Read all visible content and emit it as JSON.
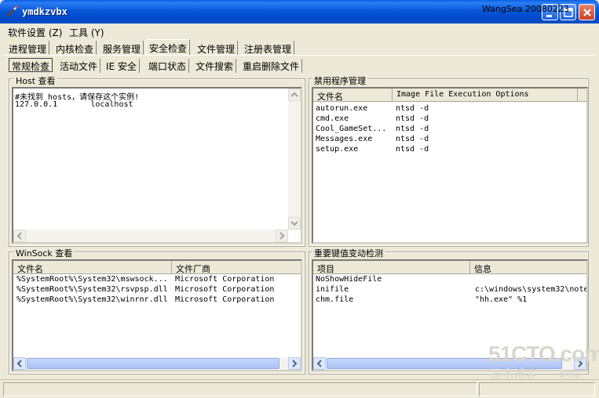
{
  "window": {
    "title": "ymdkzvbx"
  },
  "menu": [
    {
      "label": "软件设置 (Z)"
    },
    {
      "label": "工具 (Y)"
    }
  ],
  "main_tabs": [
    {
      "label": "进程管理"
    },
    {
      "label": "内核检查"
    },
    {
      "label": "服务管理"
    },
    {
      "label": "安全检查"
    },
    {
      "label": "文件管理"
    },
    {
      "label": "注册表管理"
    }
  ],
  "sub_tabs": [
    {
      "label": "常规检查"
    },
    {
      "label": "活动文件"
    },
    {
      "label": "IE 安全"
    },
    {
      "label": "端口状态"
    },
    {
      "label": "文件搜索"
    },
    {
      "label": "重启删除文件"
    }
  ],
  "host": {
    "title": "Host 查看",
    "lines": [
      "#未找到 hosts，请保存这个实例!",
      "127.0.0.1       localhost"
    ]
  },
  "banned": {
    "title": "禁用程序管理",
    "columns": [
      "文件名",
      "Image File Execution Options"
    ],
    "rows": [
      [
        "autorun.exe",
        "ntsd -d"
      ],
      [
        "cmd.exe",
        "ntsd -d"
      ],
      [
        "Cool_GameSet...",
        "ntsd -d"
      ],
      [
        "Messages.exe",
        "ntsd -d"
      ],
      [
        "setup.exe",
        "ntsd -d"
      ]
    ]
  },
  "winsock": {
    "title": "WinSock 查看",
    "columns": [
      "文件名",
      "文件厂商"
    ],
    "rows": [
      [
        "%SystemRoot%\\System32\\mswsock...",
        "Microsoft Corporation"
      ],
      [
        "%SystemRoot%\\System32\\rsvpsp.dll",
        "Microsoft Corporation"
      ],
      [
        "%SystemRoot%\\System32\\winrnr.dll",
        "Microsoft Corporation"
      ]
    ]
  },
  "keys": {
    "title": "重要键值变动检测",
    "columns": [
      "项目",
      "信息"
    ],
    "rows": [
      [
        "NoShowHideFile",
        ""
      ],
      [
        "inifile",
        "c:\\windows\\system32\\note"
      ],
      [
        "chm.file",
        "\"hh.exe\" %1"
      ]
    ]
  },
  "status": {
    "text": "WangSea 20080223"
  },
  "watermark": {
    "main": "51CTO.com",
    "sub": "技术博客",
    "blog": "Blog"
  },
  "colors": {
    "titlebar": "#0054e3",
    "face": "#ece9d8"
  },
  "icons": [
    "wand-icon",
    "minimize-icon",
    "maximize-icon",
    "close-icon",
    "arrow-up-icon",
    "arrow-down-icon",
    "arrow-left-icon",
    "arrow-right-icon"
  ]
}
